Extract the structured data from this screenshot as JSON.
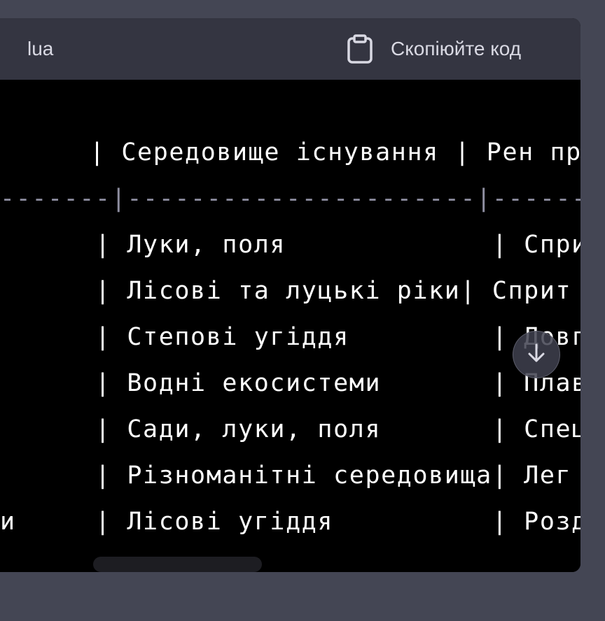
{
  "header": {
    "language": "lua",
    "copy_label": "Скопіюйте код",
    "copy_icon": "clipboard-icon"
  },
  "code": {
    "header_row": "   | Середовище існування | Рен пр",
    "separator_row": "-------|----------------------|------",
    "rows": [
      "      | Луки, поля             | Сприт",
      "      | Лісові та луцькі ріки| Сприт",
      "      | Степові угіддя         | Довгі",
      "      | Водні екосистеми       | Плава",
      "      | Сади, луки, поля       | Специ",
      "      | Різноманітні середовища| Лег",
      "и     | Лісові угіддя          | Розді"
    ]
  },
  "scroll_button_icon": "arrow-down-icon",
  "colors": {
    "page_background": "#444654",
    "header_background": "#343541",
    "code_background": "#000000",
    "text": "#ffffff",
    "separator": "#8e8ea0"
  }
}
